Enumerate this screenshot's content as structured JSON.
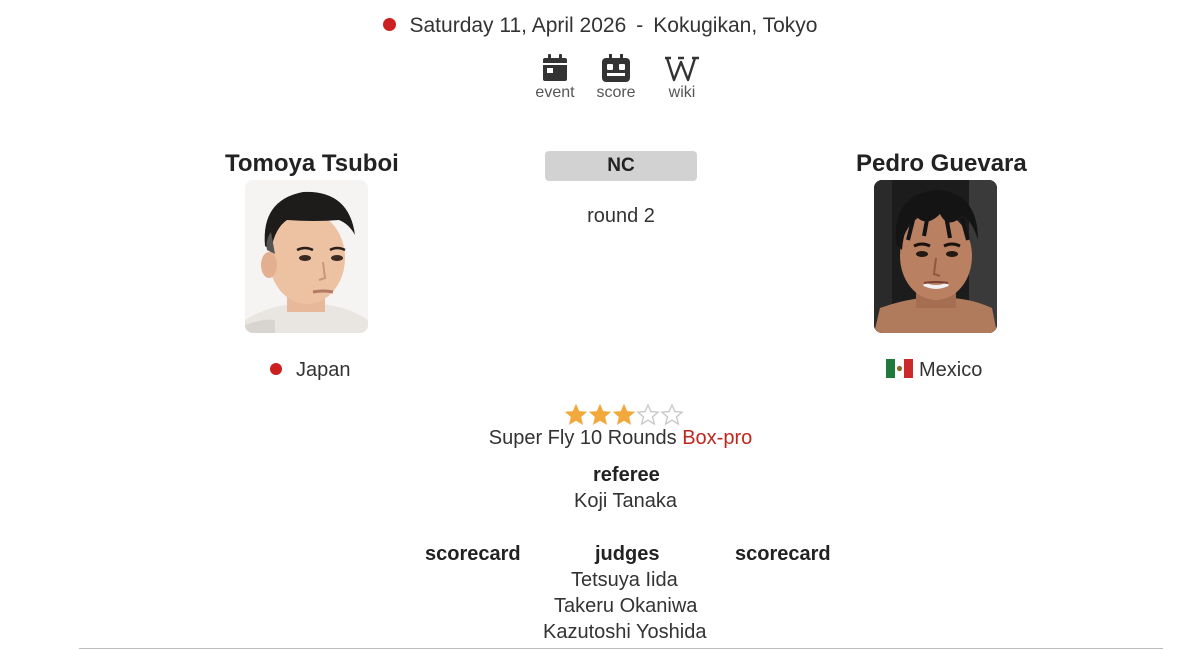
{
  "header": {
    "date": "Saturday 11, April 2026",
    "separator": "-",
    "venue": "Kokugikan, Tokyo",
    "status_color": "#cc1f1f"
  },
  "links": [
    {
      "label": "event",
      "icon": "calendar-icon"
    },
    {
      "label": "score",
      "icon": "scoreboard-icon"
    },
    {
      "label": "wiki",
      "icon": "wikipedia-icon"
    }
  ],
  "fighter_left": {
    "name": "Tomoya Tsuboi",
    "country": "Japan",
    "flag": "japan-flag-icon"
  },
  "fighter_right": {
    "name": "Pedro Guevara",
    "country": "Mexico",
    "flag": "mexico-flag-icon"
  },
  "result": {
    "outcome": "NC",
    "round": "round 2"
  },
  "rating": {
    "value": 3,
    "max": 5,
    "filled_color": "#f2a93b",
    "empty_color": "#c9c9c9"
  },
  "bout": {
    "division": "Super Fly",
    "rounds": "10 Rounds",
    "sport": "Box-pro",
    "sport_color": "#c0261c"
  },
  "officials": {
    "referee_heading": "referee",
    "referee": "Koji Tanaka",
    "scorecard_left": "scorecard",
    "judges_heading": "judges",
    "scorecard_right": "scorecard",
    "judges": [
      "Tetsuya Iida",
      "Takeru Okaniwa",
      "Kazutoshi Yoshida"
    ]
  }
}
